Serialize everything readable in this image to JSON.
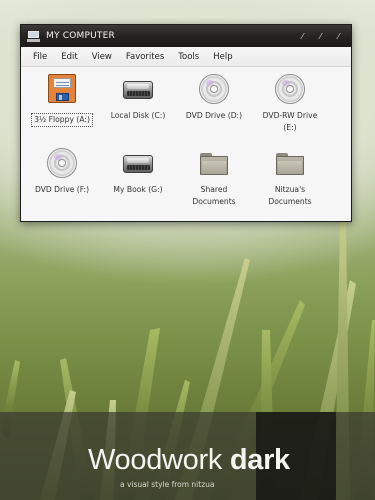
{
  "window": {
    "title": "MY COMPUTER",
    "buttons": [
      "minimize-icon",
      "maximize-icon",
      "close-icon"
    ]
  },
  "menu": [
    "File",
    "Edit",
    "View",
    "Favorites",
    "Tools",
    "Help"
  ],
  "items": [
    {
      "label": "3½ Floppy (A:)",
      "icon": "floppy-icon",
      "selected": true
    },
    {
      "label": "Local Disk (C:)",
      "icon": "hard-disk-icon"
    },
    {
      "label": "DVD Drive (D:)",
      "icon": "dvd-drive-icon"
    },
    {
      "label": "DVD-RW Drive",
      "label2": "(E:)",
      "icon": "dvd-rw-drive-icon"
    },
    {
      "label": "DVD Drive (F:)",
      "icon": "dvd-drive-icon"
    },
    {
      "label": "My Book (G:)",
      "icon": "hard-disk-icon"
    },
    {
      "label": "Shared",
      "label2": "Documents",
      "icon": "folder-icon"
    },
    {
      "label": "Nitzua's",
      "label2": "Documents",
      "icon": "folder-icon"
    }
  ],
  "banner": {
    "title_light": "Woodwork ",
    "title_bold": "dark",
    "subtitle": "a visual style from nitzua"
  },
  "colors": {
    "titlebar": "#242322",
    "window_bg": "#f4f4f4",
    "floppy": "#e3843a",
    "banner": "#3a3a30"
  }
}
